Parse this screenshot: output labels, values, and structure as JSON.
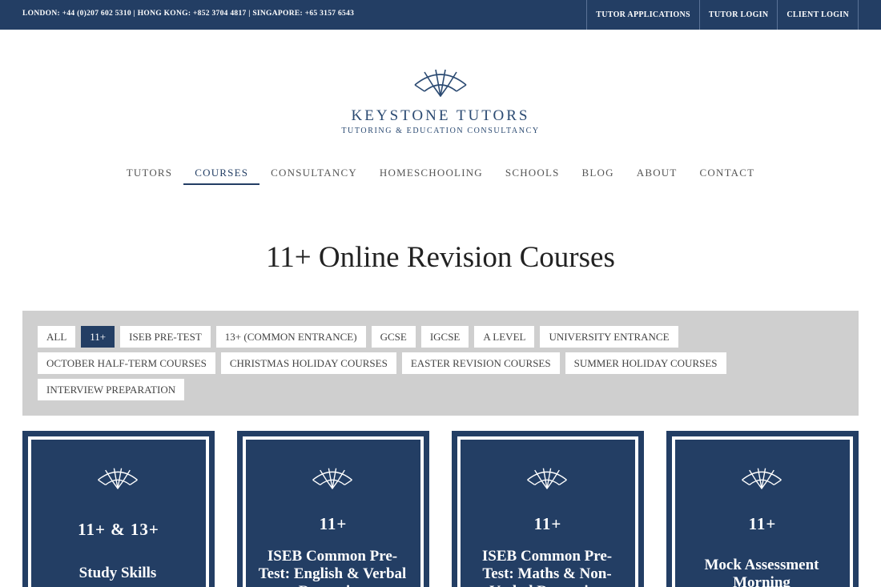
{
  "topbar": {
    "contacts": "LONDON: +44 (0)207 602 5310 | HONG KONG: +852 3704 4817 | SINGAPORE: +65 3157 6543",
    "links": [
      "TUTOR APPLICATIONS",
      "TUTOR LOGIN",
      "CLIENT LOGIN"
    ]
  },
  "brand": {
    "name": "KEYSTONE TUTORS",
    "tagline": "TUTORING & EDUCATION CONSULTANCY"
  },
  "nav": {
    "items": [
      "TUTORS",
      "COURSES",
      "CONSULTANCY",
      "HOMESCHOOLING",
      "SCHOOLS",
      "BLOG",
      "ABOUT",
      "CONTACT"
    ],
    "active": "COURSES"
  },
  "page": {
    "title": "11+ Online Revision Courses"
  },
  "filters": {
    "rows": [
      [
        "ALL",
        "11+",
        "ISEB PRE-TEST",
        "13+ (COMMON ENTRANCE)",
        "GCSE",
        "IGCSE",
        "A LEVEL",
        "UNIVERSITY ENTRANCE"
      ],
      [
        "OCTOBER HALF-TERM COURSES",
        "CHRISTMAS HOLIDAY COURSES",
        "EASTER REVISION COURSES",
        "SUMMER HOLIDAY COURSES"
      ],
      [
        "INTERVIEW PREPARATION"
      ]
    ],
    "active": "11+"
  },
  "cards": [
    {
      "level": "11+ & 13+",
      "title": "Study Skills"
    },
    {
      "level": "11+",
      "title": "ISEB Common Pre-Test: English & Verbal Reasoning"
    },
    {
      "level": "11+",
      "title": "ISEB Common Pre-Test: Maths & Non-Verbal Reasoning"
    },
    {
      "level": "11+",
      "title": "Mock Assessment Morning"
    }
  ],
  "colors": {
    "brand_navy": "#233e64",
    "filter_bg": "#cfcfcf"
  },
  "icons": {
    "logo": "keystone-arch-icon"
  }
}
